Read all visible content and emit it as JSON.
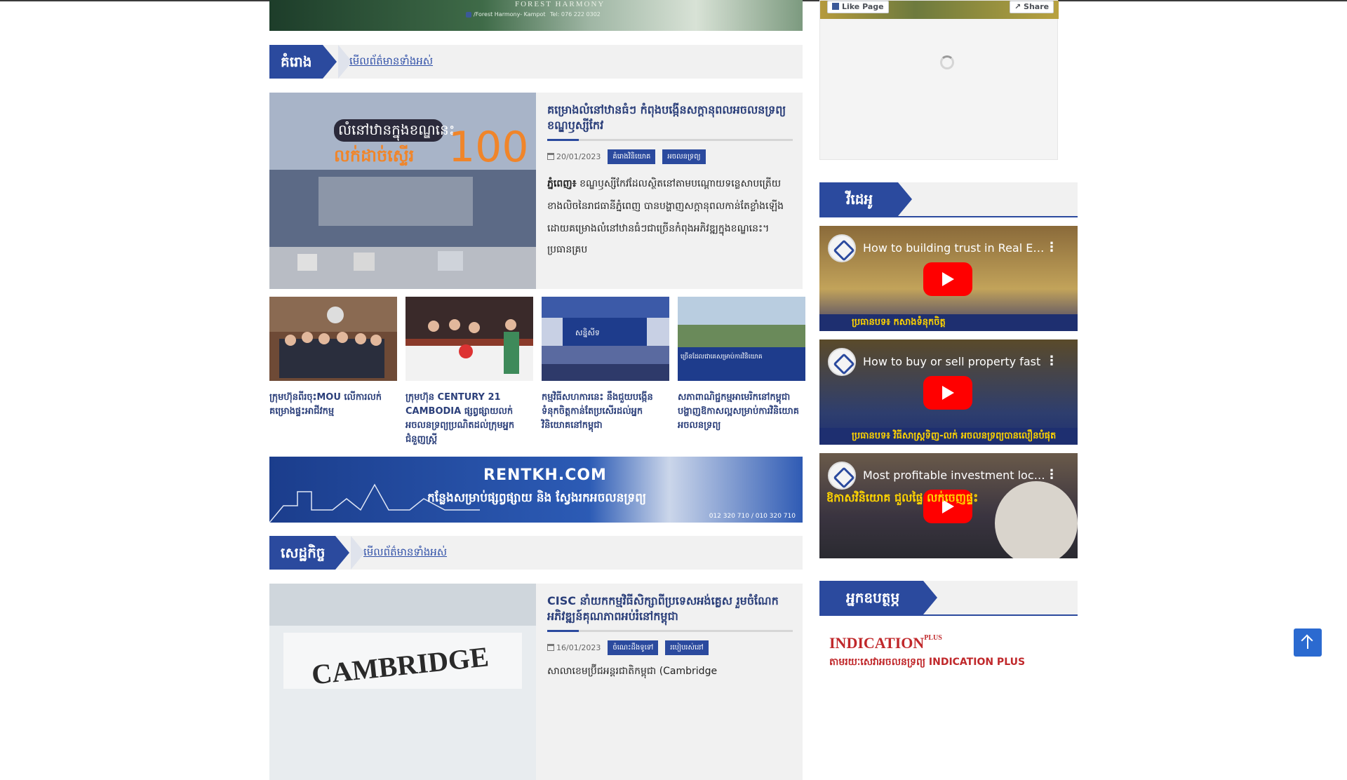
{
  "top_banner": {
    "brand": "FOREST HARMONY",
    "facebook": "/Forest Harmony- Kampot",
    "phone": "Tel: 076 222 0302"
  },
  "section1": {
    "title": "គំរោង",
    "see_all": "មើលព័ត៌មានទាំងអស់"
  },
  "featured1": {
    "image_text_line1": "លំនៅឋានក្នុងខណ្ឌនេះ",
    "image_text_line2": "លក់ដាច់ស្ទើរ",
    "image_text_number": "100",
    "title": "គម្រោងលំនៅឋានធំៗ កំពុងបង្កើនសក្ដានុពលអចលនទ្រព្យខណ្ឌឫស្សីកែវ",
    "date": "20/01/2023",
    "tags": [
      "គំរោងវិនិយោគ",
      "អចលនទ្រព្យ"
    ],
    "excerpt_lead": "ភ្នំពេញ៖",
    "excerpt": " ខណ្ឌឫស្សីកែវដែលស្ថិតនៅតាមបណ្តោយទន្លេសាបត្រើយខាងលិចនៃរាជធានីភ្នំពេញ បានបង្ហាញសក្ដានុពលកាន់តែខ្លាំងឡើង ដោយគម្រោងលំនៅឋានធំៗជាច្រើនកំពុងអភិវឌ្ឍក្នុងខណ្ឌនេះ។",
    "author": "ប្រធានគ្រប"
  },
  "thumbs": [
    {
      "caption": "ក្រុមហ៊ុនពីរចុះMOU លើការលក់គម្រោងផ្ទះអាជីវកម្ម"
    },
    {
      "caption": "ក្រុមហ៊ុន CENTURY 21 CAMBODIA ផ្សព្វផ្សាយលក់អចលនទ្រព្យប្រណិតដល់ក្រុមអ្នកជំនួញស្រ្តី"
    },
    {
      "caption": "កម្មវិធីសហការនេះ នឹងជួយបង្កើនទំនុកចិត្តកាន់តែប្រសើរដល់អ្នកវិនិយោគនៅកម្ពុជា",
      "image_text": "សន្និសីទ"
    },
    {
      "caption": "សភាពាណិជ្ជកម្មអាមេរិកនៅកម្ពុជា បង្ហាញឱកាសល្អសម្រាប់ការវិនិយោគអចលនទ្រព្យ",
      "image_text": "ច្រើនដែលជាគេសម្រាប់ការវិនិយោគ"
    }
  ],
  "rent_banner": {
    "title": "RENTKH.COM",
    "tagline": "កន្លែងសម្រាប់ផ្សព្វផ្សាយ និង ស្វែងរកអចលនទ្រព្យ",
    "phone": "012 320 710 / 010 320 710"
  },
  "section2": {
    "title": "សេដ្ឋកិច្ច",
    "see_all": "មើលព័ត៌មានទាំងអស់"
  },
  "featured2": {
    "image_text": "CAMBRIDGE",
    "title": "CISC នាំយកកម្មវិធីសិក្សាពីប្រទេសអង់គ្លេស រួមចំណែកអភិវឌ្ឍន៍គុណភាពអប់រំនៅកម្ពុជា",
    "date": "16/01/2023",
    "tags": [
      "ចំណេះដឹងទូទៅ",
      "របៀបរស់នៅ"
    ],
    "excerpt": "សាលាខេមប្រ៊ីជអន្តរជាតិកម្ពុជា (Cambridge"
  },
  "fb_widget": {
    "like": "Like Page",
    "share": "Share"
  },
  "side_video_section": {
    "title": "វីដេអូ"
  },
  "videos": [
    {
      "title": "How to building trust in Real Estate",
      "band": "ប្រធានបទ៖ កសាងទំនុកចិត្ត"
    },
    {
      "title": "How to buy or sell property fast",
      "band": "ប្រធានបទ៖ វិធីសាស្ត្រទិញ-លក់ អចលនទ្រព្យបានលឿនបំផុត"
    },
    {
      "title": "Most profitable investment location",
      "band": "ឱកាសវិនិយោគ ជួលផ្ទៃ លក់ចេញផ្ទះ"
    }
  ],
  "side_sponsor_section": {
    "title": "អ្នកឧបត្ថម្ភ"
  },
  "sponsor": {
    "logo": "INDICATION",
    "logo_sup": "PLUS",
    "line": "តាមរយៈសេវាអចលនទ្រព្យ INDICATION PLUS"
  },
  "colors": {
    "primary": "#2b4a9e",
    "link": "#3050a8",
    "youtube_red": "#ff0000"
  }
}
